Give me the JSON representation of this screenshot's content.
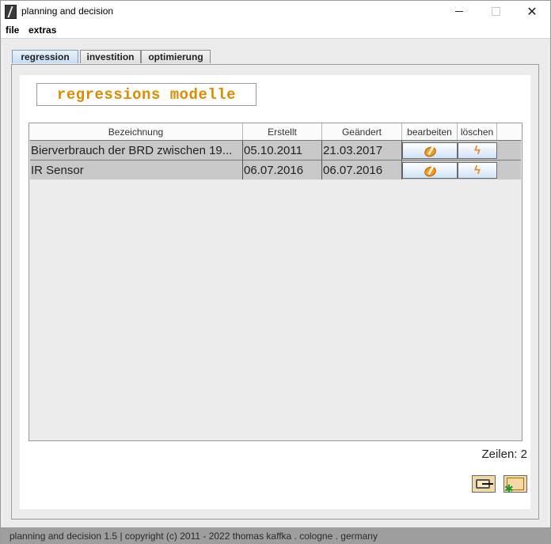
{
  "window": {
    "title": "planning and decision",
    "app_icon": "app-logo-icon",
    "controls": {
      "minimize": "minimize-icon",
      "maximize": "maximize-icon",
      "close_glyph": "✕"
    }
  },
  "menu": {
    "items": [
      {
        "label": "file"
      },
      {
        "label": "extras"
      }
    ]
  },
  "tabs": [
    {
      "label": "regression",
      "active": true
    },
    {
      "label": "investition",
      "active": false
    },
    {
      "label": "optimierung",
      "active": false
    }
  ],
  "panel": {
    "heading": "regressions modelle",
    "heading_color": "#e08a00"
  },
  "table": {
    "columns": [
      "Bezeichnung",
      "Erstellt",
      "Geändert",
      "bearbeiten",
      "löschen"
    ],
    "rows": [
      {
        "name": "Bierverbrauch der BRD zwischen 19...",
        "created": "05.10.2011",
        "changed": "21.03.2017",
        "edit_icon": "edit-icon",
        "delete_icon": "lightning-icon"
      },
      {
        "name": "IR Sensor",
        "created": "06.07.2016",
        "changed": "06.07.2016",
        "edit_icon": "edit-icon",
        "delete_icon": "lightning-icon"
      }
    ]
  },
  "rows_count_label": "Zeilen: 2",
  "actions": {
    "back_icon": "back-icon",
    "save_icon": "save-icon"
  },
  "statusbar": {
    "text": "planning and decision 1.5 | copyright (c) 2011 - 2022 thomas kaffka . cologne . germany"
  }
}
